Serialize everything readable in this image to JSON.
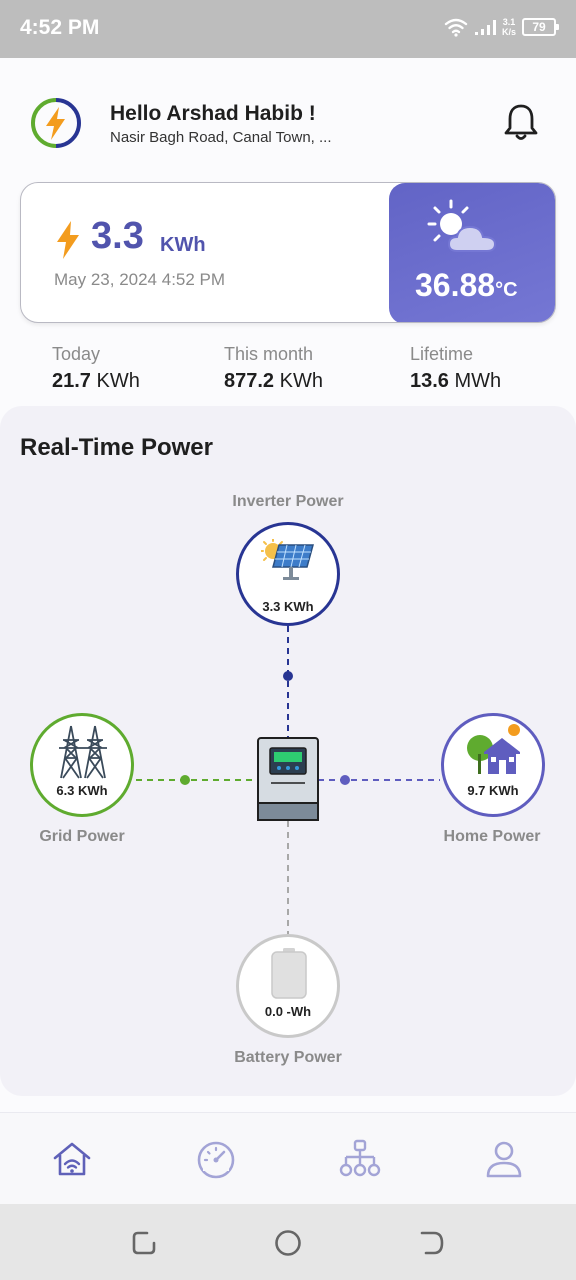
{
  "status_bar": {
    "time": "4:52 PM",
    "net_speed_value": "3.1",
    "net_speed_unit": "K/s",
    "battery": "79"
  },
  "header": {
    "greeting": "Hello Arshad Habib !",
    "address": "Nasir Bagh Road, Canal Town, ..."
  },
  "energy_card": {
    "value": "3.3",
    "unit": "KWh",
    "datetime": "May 23, 2024  4:52 PM",
    "temperature": "36.88",
    "temperature_unit": "°C"
  },
  "stats": [
    {
      "label": "Today",
      "value": "21.7",
      "unit": "KWh"
    },
    {
      "label": "This month",
      "value": "877.2",
      "unit": "KWh"
    },
    {
      "label": "Lifetime",
      "value": "13.6",
      "unit": "MWh"
    }
  ],
  "realtime": {
    "title": "Real-Time Power",
    "inverter": {
      "label": "Inverter Power",
      "value": "3.3 KWh"
    },
    "grid": {
      "label": "Grid Power",
      "value": "6.3 KWh"
    },
    "home": {
      "label": "Home Power",
      "value": "9.7 KWh"
    },
    "battery": {
      "label": "Battery Power",
      "value": "0.0 -Wh"
    }
  },
  "bottom_nav": {
    "items": [
      "home-icon",
      "dashboard-gauge-icon",
      "network-tree-icon",
      "profile-icon"
    ],
    "active_color": "#5f61b8",
    "inactive_color": "#a3a4d6"
  },
  "colors": {
    "accent": "#5154ad",
    "inverter_ring": "#283593",
    "grid_ring": "#5fab2f",
    "home_ring": "#5f5dbf",
    "battery_ring": "#c9c9c9",
    "bolt": "#f39c1e"
  }
}
